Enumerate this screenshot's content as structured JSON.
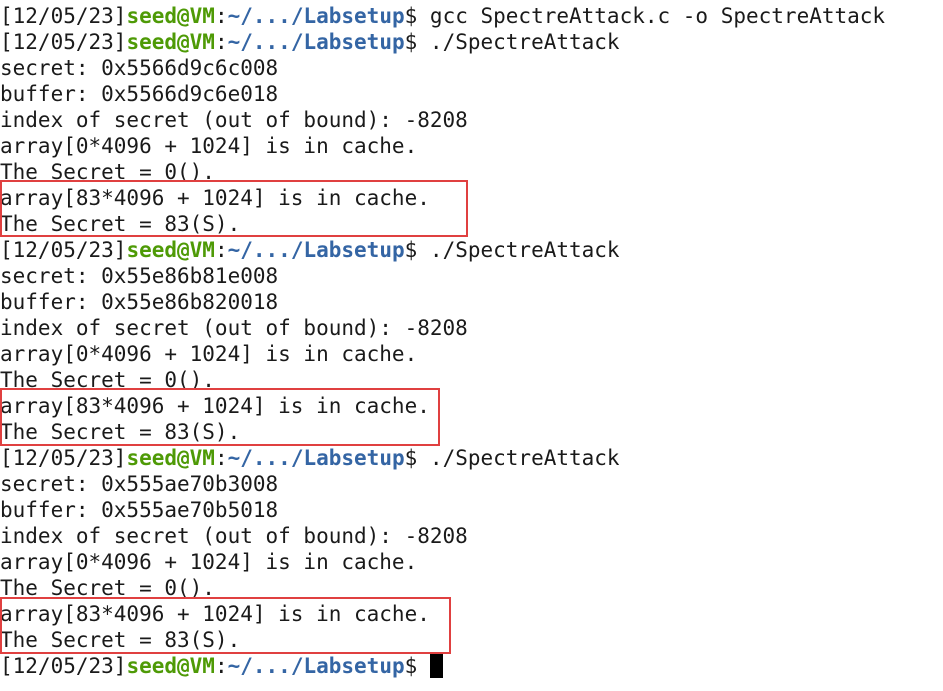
{
  "terminal": {
    "lines": [
      {
        "type": "prompt",
        "date": "[12/05/23]",
        "user": "seed@VM",
        "sep": ":",
        "path": "~/.../Labsetup",
        "sym": "$ ",
        "cmd": "gcc SpectreAttack.c -o SpectreAttack"
      },
      {
        "type": "prompt",
        "date": "[12/05/23]",
        "user": "seed@VM",
        "sep": ":",
        "path": "~/.../Labsetup",
        "sym": "$ ",
        "cmd": "./SpectreAttack"
      },
      {
        "type": "output",
        "text": "secret: 0x5566d9c6c008"
      },
      {
        "type": "output",
        "text": "buffer: 0x5566d9c6e018"
      },
      {
        "type": "output",
        "text": "index of secret (out of bound): -8208"
      },
      {
        "type": "output",
        "text": "array[0*4096 + 1024] is in cache."
      },
      {
        "type": "output",
        "text": "The Secret = 0()."
      },
      {
        "type": "output",
        "text": "array[83*4096 + 1024] is in cache."
      },
      {
        "type": "output",
        "text": "The Secret = 83(S)."
      },
      {
        "type": "prompt",
        "date": "[12/05/23]",
        "user": "seed@VM",
        "sep": ":",
        "path": "~/.../Labsetup",
        "sym": "$ ",
        "cmd": "./SpectreAttack"
      },
      {
        "type": "output",
        "text": "secret: 0x55e86b81e008"
      },
      {
        "type": "output",
        "text": "buffer: 0x55e86b820018"
      },
      {
        "type": "output",
        "text": "index of secret (out of bound): -8208"
      },
      {
        "type": "output",
        "text": "array[0*4096 + 1024] is in cache."
      },
      {
        "type": "output",
        "text": "The Secret = 0()."
      },
      {
        "type": "output",
        "text": "array[83*4096 + 1024] is in cache."
      },
      {
        "type": "output",
        "text": "The Secret = 83(S)."
      },
      {
        "type": "prompt",
        "date": "[12/05/23]",
        "user": "seed@VM",
        "sep": ":",
        "path": "~/.../Labsetup",
        "sym": "$ ",
        "cmd": "./SpectreAttack"
      },
      {
        "type": "output",
        "text": "secret: 0x555ae70b3008"
      },
      {
        "type": "output",
        "text": "buffer: 0x555ae70b5018"
      },
      {
        "type": "output",
        "text": "index of secret (out of bound): -8208"
      },
      {
        "type": "output",
        "text": "array[0*4096 + 1024] is in cache."
      },
      {
        "type": "output",
        "text": "The Secret = 0()."
      },
      {
        "type": "output",
        "text": "array[83*4096 + 1024] is in cache."
      },
      {
        "type": "output",
        "text": "The Secret = 83(S)."
      },
      {
        "type": "prompt",
        "date": "[12/05/23]",
        "user": "seed@VM",
        "sep": ":",
        "path": "~/.../Labsetup",
        "sym": "$ ",
        "cmd": "",
        "cursor": true
      }
    ]
  },
  "colors": {
    "user": "#4e9a06",
    "path": "#3465a4",
    "text": "#1a1a1a",
    "highlight_box": "#e04040",
    "background": "#ffffff"
  }
}
